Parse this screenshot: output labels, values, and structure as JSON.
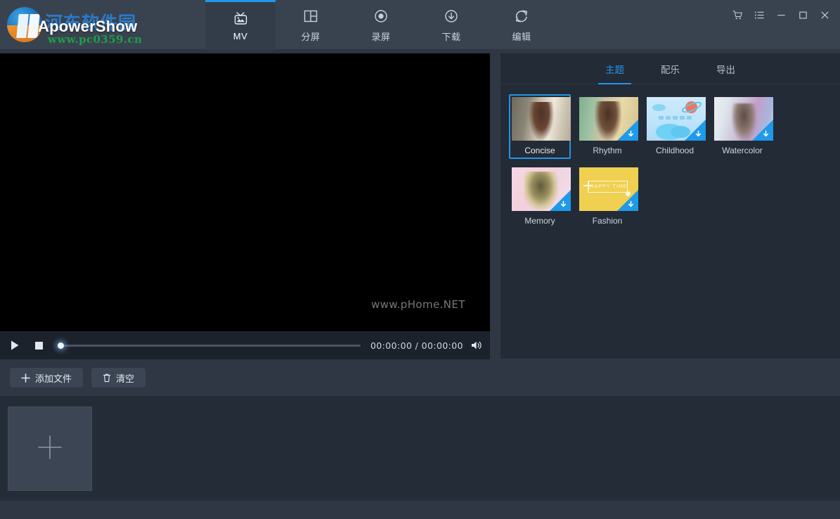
{
  "app": {
    "brand_name": "ApowerShow",
    "watermark_cn": "河东软件园",
    "watermark_url": "www.pc0359.cn",
    "accent_color": "#2196e8",
    "titlebar_color": "#39434f",
    "body_color": "#2e3743"
  },
  "nav": {
    "tabs": [
      {
        "label": "MV",
        "icon": "tv-image-icon",
        "active": true
      },
      {
        "label": "分屏",
        "icon": "split-screen-icon",
        "active": false
      },
      {
        "label": "录屏",
        "icon": "record-circle-icon",
        "active": false
      },
      {
        "label": "下载",
        "icon": "download-circle-icon",
        "active": false
      },
      {
        "label": "编辑",
        "icon": "refresh-edit-icon",
        "active": false
      }
    ]
  },
  "window_controls": [
    {
      "name": "cart-icon",
      "glyph": "cart"
    },
    {
      "name": "menu-list-icon",
      "glyph": "list"
    },
    {
      "name": "minimize-icon",
      "glyph": "minimize"
    },
    {
      "name": "maximize-icon",
      "glyph": "maximize"
    },
    {
      "name": "close-icon",
      "glyph": "close"
    }
  ],
  "preview": {
    "watermark": "www.pHome.NET",
    "background": "#000000"
  },
  "player": {
    "play_label": "play-button",
    "stop_label": "stop-button",
    "current_time": "00:00:00",
    "total_time": "00:00:00",
    "time_display": "00:00:00 / 00:00:00",
    "progress_percent": 0,
    "volume_icon": "volume-icon"
  },
  "actions": {
    "add_files_label": "添加文件",
    "add_files_glyph": "+",
    "clear_label": "清空",
    "clear_glyph": "🗑"
  },
  "timeline": {
    "add_tile_label": "+",
    "clips": []
  },
  "right_panel": {
    "tabs": [
      {
        "label": "主题",
        "active": true
      },
      {
        "label": "配乐",
        "active": false
      },
      {
        "label": "导出",
        "active": false
      }
    ],
    "themes": [
      {
        "name": "Concise",
        "art": "art-girl-a",
        "selected": true,
        "downloadable": false
      },
      {
        "name": "Rhythm",
        "art": "art-girl-b",
        "selected": false,
        "downloadable": true
      },
      {
        "name": "Childhood",
        "art": "art-child",
        "selected": false,
        "downloadable": true
      },
      {
        "name": "Watercolor",
        "art": "art-water",
        "selected": false,
        "downloadable": true
      },
      {
        "name": "Memory",
        "art": "art-memory",
        "selected": false,
        "downloadable": true
      },
      {
        "name": "Fashion",
        "art": "art-fashion",
        "selected": false,
        "downloadable": true,
        "caption": "HAPPY TIME"
      }
    ]
  }
}
